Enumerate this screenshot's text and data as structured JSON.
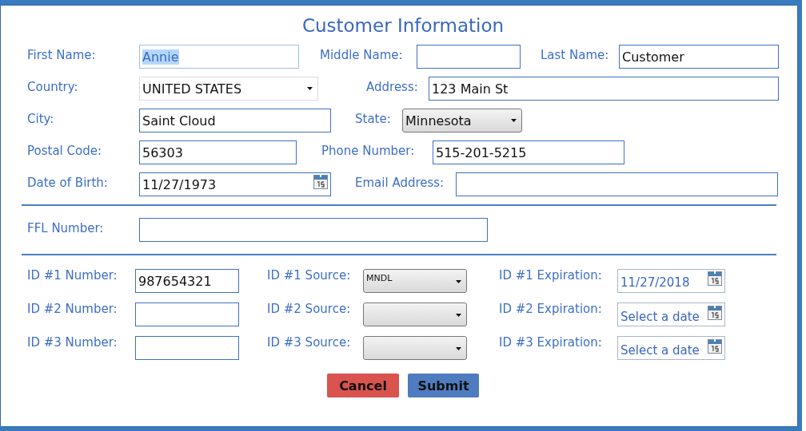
{
  "title": "Customer Information",
  "rows": [
    {
      "fields": [
        {
          "label": "First Name:",
          "kind": "text",
          "value": "Annie",
          "highlighted": true
        },
        {
          "label": "Middle Name:",
          "kind": "text",
          "highlighted": false
        },
        {
          "label": "Last Name:",
          "kind": "text",
          "value": "Customer",
          "highlighted": false
        }
      ]
    },
    {
      "fields": [
        {
          "label": "Country:",
          "kind": "dropdown",
          "value": "UNITED STATES",
          "highlighted": false
        },
        {
          "label": "Address:",
          "kind": "text",
          "value": "123 Main St",
          "highlighted": false
        }
      ]
    },
    {
      "fields": [
        {
          "label": "City:",
          "kind": "text",
          "value": "Saint Cloud",
          "highlighted": false
        },
        {
          "label": "State:",
          "kind": "picker",
          "value": "Minnesota",
          "highlighted": false
        }
      ]
    },
    {
      "fields": [
        {
          "label": "Postal Code:",
          "kind": "text",
          "value": "56303",
          "highlighted": false
        },
        {
          "label": "Phone Number:",
          "kind": "text",
          "value": "515-201-5215",
          "highlighted": false
        }
      ]
    },
    {
      "fields": [
        {
          "label": "Date of Birth:",
          "kind": "date",
          "value": "11/27/1973",
          "highlighted": false
        },
        {
          "label": "Email Address:",
          "kind": "text",
          "highlighted": false
        }
      ]
    }
  ],
  "ffl": {
    "label": "FFL Number:"
  },
  "id_rows": [
    {
      "number": {
        "label": "ID #1 Number:",
        "value": "987654321"
      },
      "source": {
        "label": "ID #1 Source:",
        "value": "MNDL"
      },
      "expiration": {
        "label": "ID #1 Expiration:",
        "value": "11/27/2018"
      }
    },
    {
      "number": {
        "label": "ID #2 Number:"
      },
      "source": {
        "label": "ID #2 Source:"
      },
      "expiration": {
        "label": "ID #2 Expiration:",
        "placeholder": "Select a date"
      }
    },
    {
      "number": {
        "label": "ID #3 Number:"
      },
      "source": {
        "label": "ID #3 Source:"
      },
      "expiration": {
        "label": "ID #3 Expiration:",
        "placeholder": "Select a date"
      }
    }
  ],
  "buttons": [
    {
      "label": "Cancel",
      "kind": "cancel"
    },
    {
      "label": "Submit",
      "kind": "submit"
    }
  ]
}
